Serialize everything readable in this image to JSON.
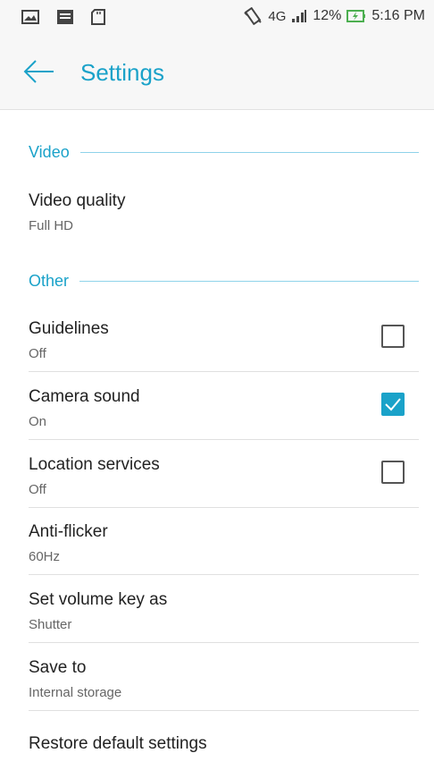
{
  "status_bar": {
    "network": "4G",
    "battery_percent": "12%",
    "time": "5:16 PM",
    "icons": [
      "image-icon",
      "notification-card-icon",
      "sd-card-icon",
      "vibrate-icon",
      "signal-icon",
      "battery-charging-icon"
    ]
  },
  "header": {
    "title": "Settings",
    "back_icon": "arrow-left-icon"
  },
  "sections": {
    "video": {
      "label": "Video"
    },
    "other": {
      "label": "Other"
    }
  },
  "settings": {
    "video_quality": {
      "title": "Video quality",
      "value": "Full HD"
    },
    "guidelines": {
      "title": "Guidelines",
      "value": "Off",
      "checked": false
    },
    "camera_sound": {
      "title": "Camera sound",
      "value": "On",
      "checked": true
    },
    "location_services": {
      "title": "Location services",
      "value": "Off",
      "checked": false
    },
    "anti_flicker": {
      "title": "Anti-flicker",
      "value": "60Hz"
    },
    "volume_key": {
      "title": "Set volume key as",
      "value": "Shutter"
    },
    "save_to": {
      "title": "Save to",
      "value": "Internal storage"
    },
    "restore": {
      "title": "Restore default settings"
    }
  },
  "colors": {
    "accent": "#1aa2c9",
    "checkbox_checked": "#1aa2c9"
  }
}
